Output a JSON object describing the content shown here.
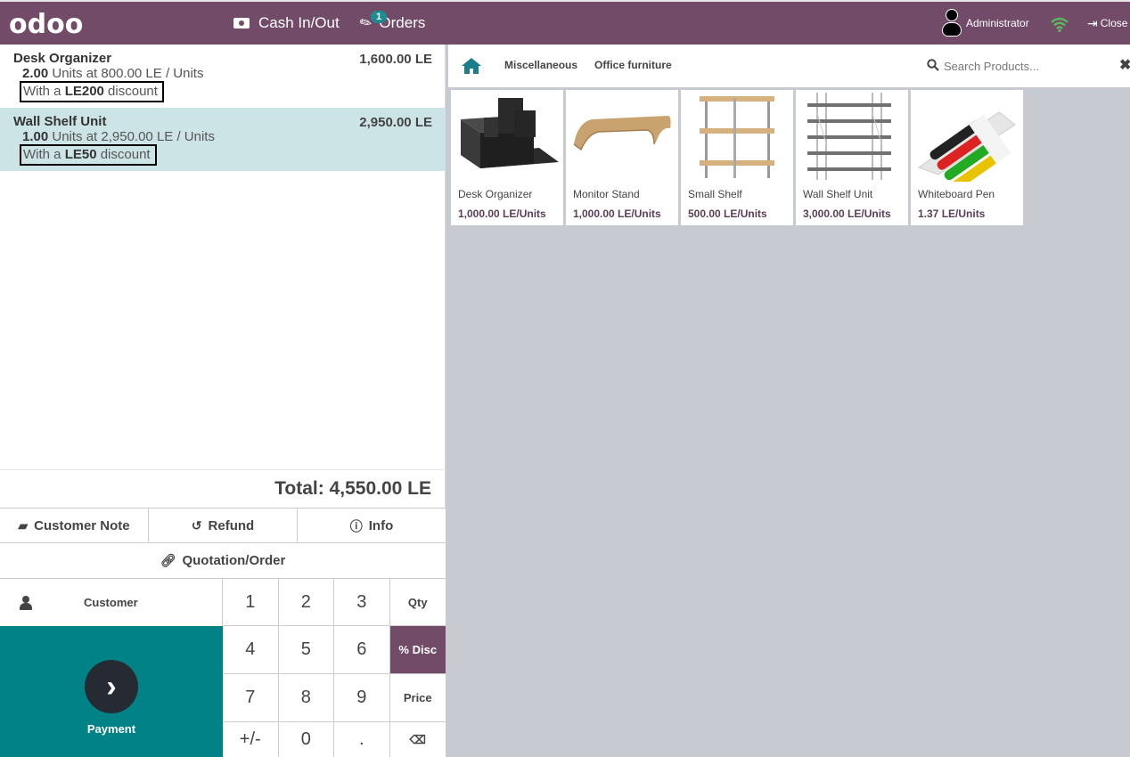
{
  "header": {
    "logo": "odoo",
    "cash_in_out": "Cash In/Out",
    "orders": "Orders",
    "orders_badge": "1",
    "user": "Administrator",
    "close": "Close"
  },
  "order": {
    "lines": [
      {
        "name": "Desk Organizer",
        "price": "1,600.00 LE",
        "qty": "2.00",
        "unit_info": " Units at 800.00 LE / Units",
        "disc_prefix": "With a ",
        "disc_amount": "LE200",
        "disc_suffix": " discount"
      },
      {
        "name": "Wall Shelf Unit",
        "price": "2,950.00 LE",
        "qty": "1.00",
        "unit_info": " Units at 2,950.00 LE / Units",
        "disc_prefix": "With a ",
        "disc_amount": "LE50",
        "disc_suffix": " discount"
      }
    ],
    "total": "Total: 4,550.00 LE"
  },
  "controls": {
    "customer_note": "Customer Note",
    "refund": "Refund",
    "info": "Info",
    "quotation": "Quotation/Order",
    "customer": "Customer",
    "payment": "Payment"
  },
  "numpad": {
    "keys": [
      "1",
      "2",
      "3",
      "Qty",
      "4",
      "5",
      "6",
      "% Disc",
      "7",
      "8",
      "9",
      "Price",
      "+/-",
      "0",
      ".",
      "⌫"
    ],
    "active_mode": "% Disc"
  },
  "categories": {
    "items": [
      "Miscellaneous",
      "Office furniture"
    ]
  },
  "search": {
    "placeholder": "Search Products..."
  },
  "products": [
    {
      "name": "Desk Organizer",
      "price": "1,000.00 LE/Units"
    },
    {
      "name": "Monitor Stand",
      "price": "1,000.00 LE/Units"
    },
    {
      "name": "Small Shelf",
      "price": "500.00 LE/Units"
    },
    {
      "name": "Wall Shelf Unit",
      "price": "3,000.00 LE/Units"
    },
    {
      "name": "Whiteboard Pen",
      "price": "1.37 LE/Units"
    }
  ],
  "colors": {
    "brand": "#714b67",
    "payment": "#018286",
    "selected_line": "#cde4e6",
    "badge": "#1c8b92"
  }
}
